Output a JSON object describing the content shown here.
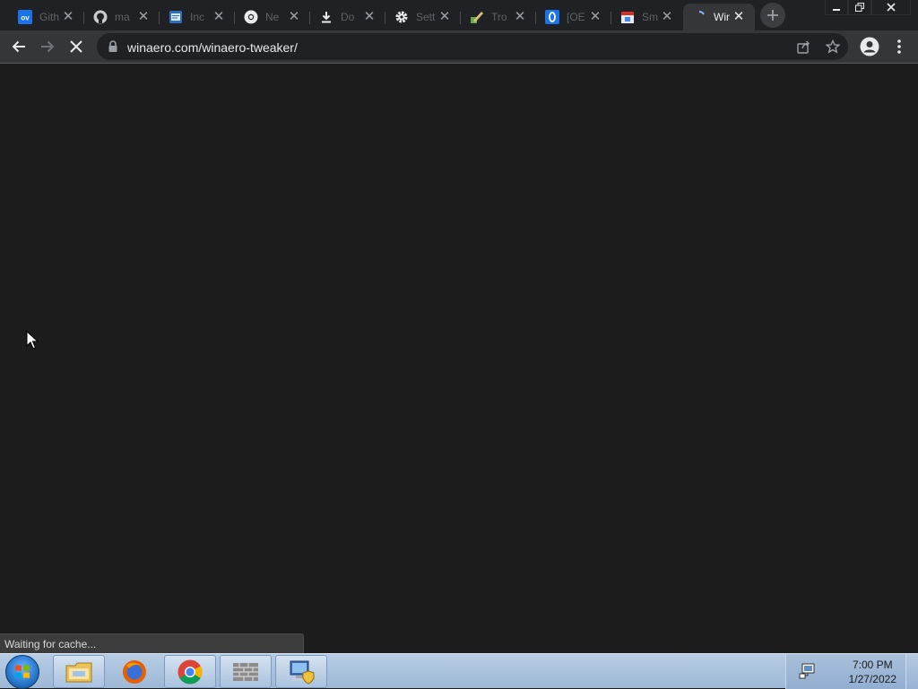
{
  "browser": {
    "tabs": [
      {
        "title": "Gith",
        "icon": "ov-icon",
        "active": false
      },
      {
        "title": "ma",
        "icon": "github-icon",
        "active": false
      },
      {
        "title": "Inc",
        "icon": "internet-explorer-icon",
        "active": false
      },
      {
        "title": "Ne",
        "icon": "chrome-icon",
        "active": false
      },
      {
        "title": "Do",
        "icon": "download-icon",
        "active": false
      },
      {
        "title": "Sett",
        "icon": "gear-icon",
        "active": false
      },
      {
        "title": "Tro",
        "icon": "tweaker-icon",
        "active": false
      },
      {
        "title": "[OE",
        "icon": "opera-icon",
        "active": false
      },
      {
        "title": "Sm",
        "icon": "store-icon",
        "active": false
      },
      {
        "title": "Win",
        "icon": "loading-spinner-icon",
        "active": true
      }
    ],
    "address_bar": {
      "url": "winaero.com/winaero-tweaker/"
    },
    "status_bubble": "Waiting for cache..."
  },
  "taskbar": {
    "apps": [
      "start-orb-icon",
      "file-explorer-icon",
      "firefox-icon",
      "chrome-icon",
      "firewall-icon",
      "network-computer-icon"
    ],
    "clock": {
      "time": "7:00 PM",
      "date": "1/27/2022"
    }
  }
}
